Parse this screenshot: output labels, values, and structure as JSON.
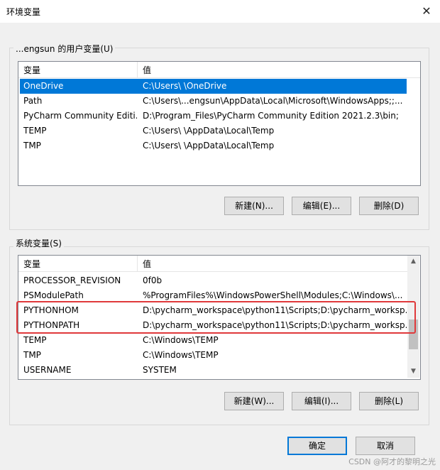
{
  "window": {
    "title": "环境变量",
    "close_icon": "close-icon"
  },
  "user_vars": {
    "group_label": "...engsun 的用户变量(U)",
    "columns": [
      "变量",
      "值"
    ],
    "rows": [
      {
        "name": "OneDrive",
        "value": "C:\\Users\\          \\OneDrive",
        "selected": true
      },
      {
        "name": "Path",
        "value": "C:\\Users\\...engsun\\AppData\\Local\\Microsoft\\WindowsApps;;..."
      },
      {
        "name": "PyCharm Community Editi...",
        "value": "D:\\Program_Files\\PyCharm Community Edition 2021.2.3\\bin;"
      },
      {
        "name": "TEMP",
        "value": "C:\\Users\\         \\AppData\\Local\\Temp"
      },
      {
        "name": "TMP",
        "value": "C:\\Users\\         \\AppData\\Local\\Temp"
      }
    ],
    "buttons": {
      "new": "新建(N)...",
      "edit": "编辑(E)...",
      "delete": "删除(D)"
    }
  },
  "system_vars": {
    "group_label": "系统变量(S)",
    "columns": [
      "变量",
      "值"
    ],
    "rows": [
      {
        "name": "PROCESSOR_REVISION",
        "value": "0f0b"
      },
      {
        "name": "PSModulePath",
        "value": "%ProgramFiles%\\WindowsPowerShell\\Modules;C:\\Windows\\..."
      },
      {
        "name": "PYTHONHOM",
        "value": "D:\\pycharm_workspace\\python11\\Scripts;D:\\pycharm_worksp..."
      },
      {
        "name": "PYTHONPATH",
        "value": "D:\\pycharm_workspace\\python11\\Scripts;D:\\pycharm_worksp..."
      },
      {
        "name": "TEMP",
        "value": "C:\\Windows\\TEMP"
      },
      {
        "name": "TMP",
        "value": "C:\\Windows\\TEMP"
      },
      {
        "name": "USERNAME",
        "value": "SYSTEM"
      }
    ],
    "buttons": {
      "new": "新建(W)...",
      "edit": "编辑(I)...",
      "delete": "删除(L)"
    },
    "scroll_position": 0.62
  },
  "footer": {
    "ok": "确定",
    "cancel": "取消"
  },
  "watermark": "CSDN @阿才的黎明之光",
  "colors": {
    "selection": "#0078d7",
    "highlight_box": "#e0393b",
    "default_button_border": "#0078d7"
  }
}
